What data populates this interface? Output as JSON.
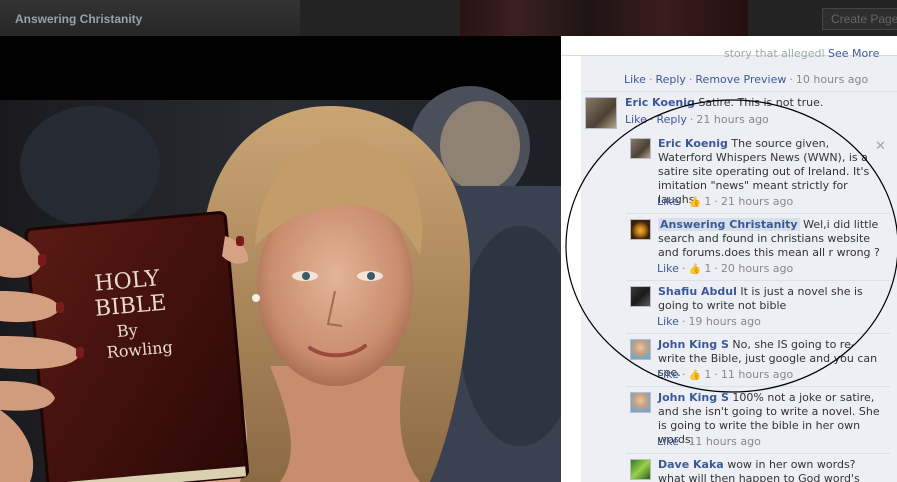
{
  "topbar": {
    "page_name": "Answering Christanity",
    "page_sub": "",
    "create_button": "Create Page"
  },
  "photo": {
    "book_line1": "HOLY",
    "book_line2": "BIBLE",
    "book_line3": "By",
    "book_line4": "Rowling"
  },
  "post": {
    "story_text": "story that allegedl",
    "see_more": "See More",
    "actions": {
      "like": "Like",
      "reply": "Reply",
      "remove_preview": "Remove Preview",
      "time": "10 hours ago"
    }
  },
  "comments": [
    {
      "author": "Eric Koenig",
      "text": "Satire. This is not true.",
      "like": "Like",
      "reply": "Reply",
      "likes": "",
      "time": "21 hours ago"
    },
    {
      "author": "Eric Koenig",
      "text": "The source given, Waterford Whispers News (WWN), is a satire site operating out of Ireland. It's imitation \"news\" meant strictly for laughs.",
      "like": "Like",
      "likes": "1",
      "time": "21 hours ago"
    },
    {
      "author": "Answering Christanity",
      "text": "Wel,i did little search and found in christians website and forums.does this mean all r wrong ?",
      "like": "Like",
      "likes": "1",
      "time": "20 hours ago"
    },
    {
      "author": "Shafiu Abdul",
      "text": "It is just a novel she is going to write not bible",
      "like": "Like",
      "likes": "",
      "time": "19 hours ago"
    },
    {
      "author": "John King S",
      "text": "No, she IS going to re-write the Bible, just google and you can see.",
      "like": "Like",
      "likes": "1",
      "time": "11 hours ago"
    },
    {
      "author": "John King S",
      "text": "100% not a joke or satire, and she isn't going to write a novel. She is going to write the bible in her own words.",
      "like": "Like",
      "likes": "",
      "time": "11 hours ago"
    },
    {
      "author": "Dave Kaka",
      "text": "wow in her own words? what will then happen to God word's",
      "like": "",
      "likes": "",
      "time": ""
    }
  ],
  "icons": {
    "close": "close-icon",
    "thumb": "thumbs-up-icon"
  },
  "colors": {
    "link": "#3b5998",
    "panel_bg": "#edeff4",
    "ellipse": "#000000"
  }
}
